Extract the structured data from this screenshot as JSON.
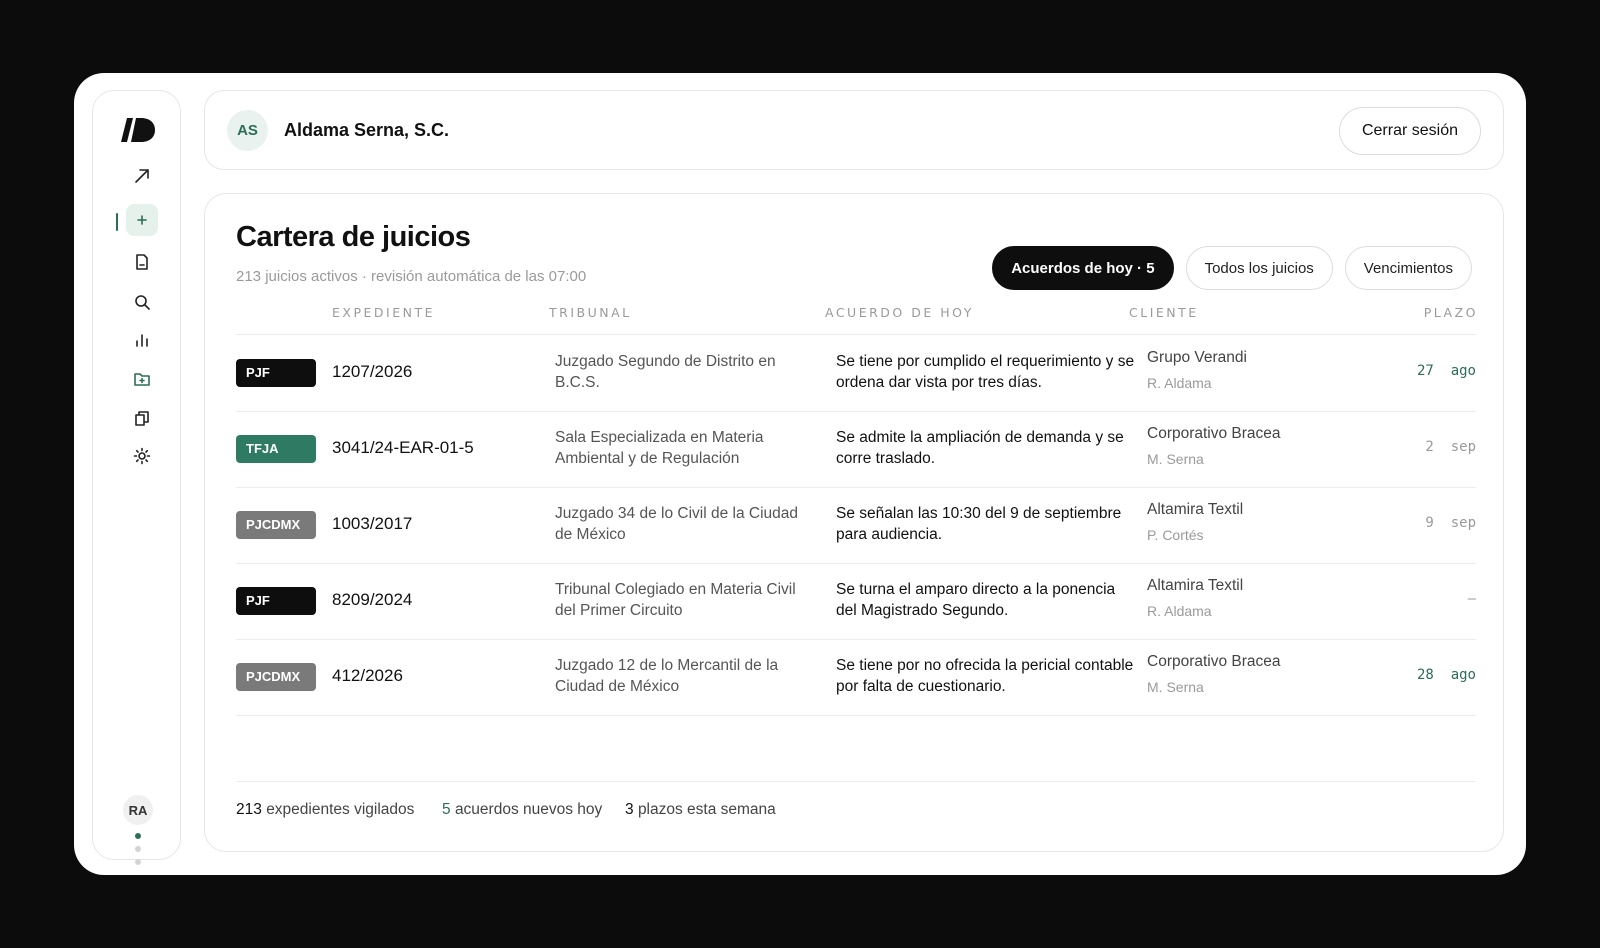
{
  "sidebar": {
    "icons": [
      "arrow-up-right-icon",
      "plus-icon",
      "document-icon",
      "search-icon",
      "bar-chart-icon",
      "folder-icon",
      "files-icon",
      "sun-icon"
    ],
    "user_initials": "RA"
  },
  "header": {
    "org_initials": "AS",
    "org_name": "Aldama Serna, S.C.",
    "logout_label": "Cerrar sesión"
  },
  "main": {
    "title": "Cartera de juicios",
    "subtitle": "213 juicios activos · revisión automática de las 07:00",
    "filters": [
      {
        "label": "Acuerdos de hoy · 5",
        "active": true
      },
      {
        "label": "Todos los juicios",
        "active": false
      },
      {
        "label": "Vencimientos",
        "active": false
      }
    ],
    "columns": {
      "expediente": "EXPEDIENTE",
      "tribunal": "TRIBUNAL",
      "acuerdo": "ACUERDO DE HOY",
      "cliente": "CLIENTE",
      "plazo": "PLAZO"
    },
    "rows": [
      {
        "badge": "PJF",
        "expediente": "1207/2026",
        "tribunal": "Juzgado Segundo de Distrito en B.C.S.",
        "acuerdo": "Se tiene por cumplido el requerimiento y se ordena dar vista por tres días.",
        "cliente": "Grupo Verandi",
        "abogado": "R. Aldama",
        "plazo": "27  ago"
      },
      {
        "badge": "TFJA",
        "expediente": "3041/24-EAR-01-5",
        "tribunal": "Sala Especializada en Materia Ambiental y de Regulación",
        "acuerdo": "Se admite la ampliación de demanda y se corre traslado.",
        "cliente": "Corporativo Bracea",
        "abogado": "M. Serna",
        "plazo": "2  sep"
      },
      {
        "badge": "PJCDMX",
        "expediente": "1003/2017",
        "tribunal": "Juzgado 34 de lo Civil de la Ciudad de México",
        "acuerdo": "Se señalan las 10:30 del 9 de septiembre para audiencia.",
        "cliente": "Altamira Textil",
        "abogado": "P. Cortés",
        "plazo": "9  sep"
      },
      {
        "badge": "PJF",
        "expediente": "8209/2024",
        "tribunal": "Tribunal Colegiado en Materia Civil del Primer Circuito",
        "acuerdo": "Se turna el amparo directo a la ponencia del Magistrado Segundo.",
        "cliente": "Altamira Textil",
        "abogado": "R. Aldama",
        "plazo": "–"
      },
      {
        "badge": "PJCDMX",
        "expediente": "412/2026",
        "tribunal": "Juzgado 12 de lo Mercantil de la Ciudad de México",
        "acuerdo": "Se tiene por no ofrecida la pericial contable por falta de cuestionario.",
        "cliente": "Corporativo Bracea",
        "abogado": "M. Serna",
        "plazo": "28  ago"
      }
    ],
    "footer": {
      "vigilados_num": "213",
      "vigilados_label": "expedientes vigilados",
      "acuerdos_num": "5",
      "acuerdos_label": "acuerdos nuevos hoy",
      "plazos_num": "3",
      "plazos_label": "plazos esta semana"
    }
  },
  "colors": {
    "accent": "#2c6e57",
    "badge_pjf": "#0e0e0e",
    "badge_tfja": "#2f7a63",
    "badge_pjcdmx": "#7a7a7a",
    "plazo_urgent": "#2c6e57",
    "plazo_normal": "#9a9a9a"
  }
}
